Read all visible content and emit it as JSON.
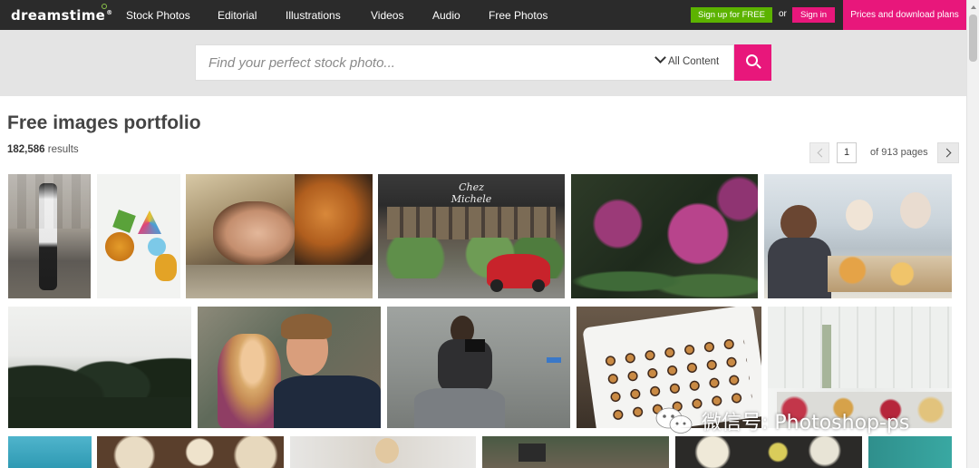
{
  "header": {
    "logo": "dreamstime",
    "logo_mark": "®",
    "nav": [
      "Stock Photos",
      "Editorial",
      "Illustrations",
      "Videos",
      "Audio",
      "Free Photos"
    ],
    "signup_label": "Sign up for FREE",
    "or_label": "or",
    "signin_label": "Sign in",
    "prices_label": "Prices and download plans"
  },
  "search": {
    "placeholder": "Find your perfect stock photo...",
    "content_filter": "All Content"
  },
  "main": {
    "title": "Free images portfolio",
    "results_count": "182,586",
    "results_label": "results",
    "pagination": {
      "current_page": "1",
      "of_label": "of 913 pages"
    }
  },
  "grid": {
    "thumbnails": [
      "woman-walking-winter-street",
      "tropical-fruits-party-hat",
      "woman-lying-on-ground-portrait",
      "chez-michele-storefront-scooter",
      "purple-rhododendron-flowers",
      "couple-having-meal-cafe",
      "palm-leaves-silhouette",
      "couple-kissing-outdoors",
      "photographer-crouching-street",
      "pastries-on-tray",
      "dessert-cups-table",
      "sea-blue-sky",
      "price-tags-display",
      "woman-smiling-outdoor",
      "flower-market-stall",
      "food-platter-top-view",
      "teal-wall"
    ]
  },
  "watermark": {
    "text": "微信号: Photoshop-ps"
  },
  "colors": {
    "topbar": "#2b2b2b",
    "brand_pink": "#e8177b",
    "signup_green": "#5cb300",
    "search_band": "#e4e4e4"
  }
}
